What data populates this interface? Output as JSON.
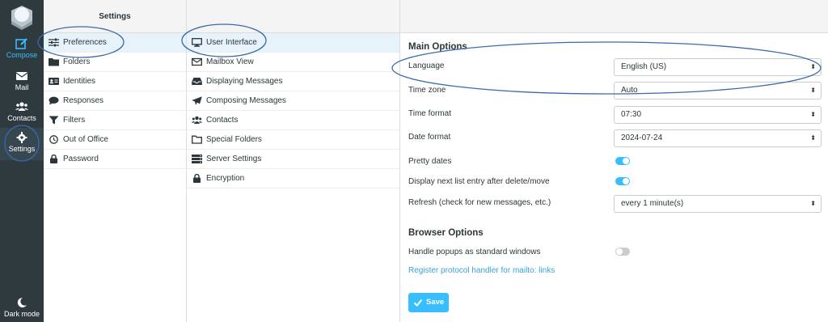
{
  "colors": {
    "accent": "#37beff",
    "rail_bg": "#2f3a3f",
    "selected_bg": "#e6f3fb",
    "annotation": "#3a6aab"
  },
  "rail": {
    "items": [
      {
        "label": "Compose",
        "icon": "compose-icon"
      },
      {
        "label": "Mail",
        "icon": "envelope-icon"
      },
      {
        "label": "Contacts",
        "icon": "users-icon"
      },
      {
        "label": "Settings",
        "icon": "gear-icon"
      }
    ],
    "dark_mode": {
      "label": "Dark mode",
      "icon": "moon-icon"
    }
  },
  "settings_panel": {
    "title": "Settings",
    "items": [
      {
        "label": "Preferences",
        "icon": "sliders-icon"
      },
      {
        "label": "Folders",
        "icon": "folder-icon"
      },
      {
        "label": "Identities",
        "icon": "id-card-icon"
      },
      {
        "label": "Responses",
        "icon": "comment-icon"
      },
      {
        "label": "Filters",
        "icon": "filter-icon"
      },
      {
        "label": "Out of Office",
        "icon": "clock-icon"
      },
      {
        "label": "Password",
        "icon": "lock-icon"
      }
    ]
  },
  "sections_panel": {
    "items": [
      {
        "label": "User Interface",
        "icon": "monitor-icon"
      },
      {
        "label": "Mailbox View",
        "icon": "envelope-outline-icon"
      },
      {
        "label": "Displaying Messages",
        "icon": "inbox-icon"
      },
      {
        "label": "Composing Messages",
        "icon": "paper-plane-icon"
      },
      {
        "label": "Contacts",
        "icon": "users-icon"
      },
      {
        "label": "Special Folders",
        "icon": "folder-outline-icon"
      },
      {
        "label": "Server Settings",
        "icon": "server-icon"
      },
      {
        "label": "Encryption",
        "icon": "lock-icon"
      }
    ]
  },
  "form": {
    "main_title": "Main Options",
    "language": {
      "label": "Language",
      "value": "English (US)"
    },
    "timezone": {
      "label": "Time zone",
      "value": "Auto"
    },
    "time_format": {
      "label": "Time format",
      "value": "07:30"
    },
    "date_format": {
      "label": "Date format",
      "value": "2024-07-24"
    },
    "pretty_dates": {
      "label": "Pretty dates",
      "on": true
    },
    "next_entry": {
      "label": "Display next list entry after delete/move",
      "on": true
    },
    "refresh": {
      "label": "Refresh (check for new messages, etc.)",
      "value": "every 1 minute(s)"
    },
    "browser_title": "Browser Options",
    "popups": {
      "label": "Handle popups as standard windows",
      "on": false
    },
    "protocol_link": "Register protocol handler for mailto: links",
    "save_label": "Save"
  }
}
